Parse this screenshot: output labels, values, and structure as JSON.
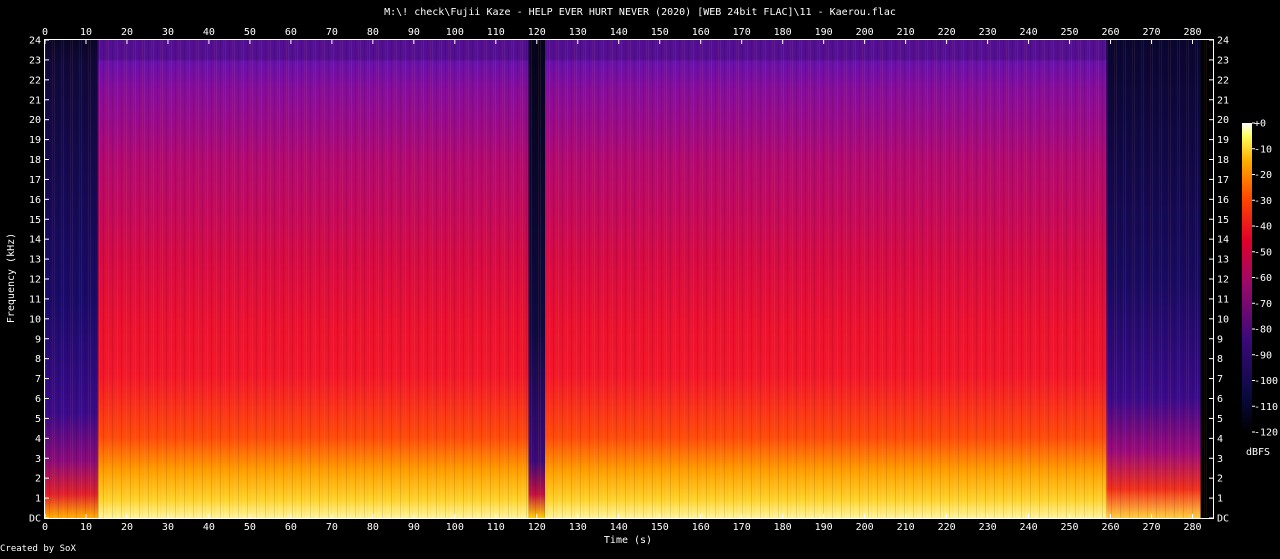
{
  "title": "M:\\! check\\Fujii Kaze - HELP EVER HURT NEVER (2020) [WEB 24bit FLAC]\\11 - Kaerou.flac",
  "footer": "Created by SoX",
  "chart_data": {
    "type": "heatmap",
    "title": "M:\\! check\\Fujii Kaze - HELP EVER HURT NEVER (2020) [WEB 24bit FLAC]\\11 - Kaerou.flac",
    "xlabel": "Time (s)",
    "ylabel": "Frequency (kHz)",
    "xlim": [
      0,
      285
    ],
    "ylim": [
      0,
      24
    ],
    "x_ticks": [
      0,
      10,
      20,
      30,
      40,
      50,
      60,
      70,
      80,
      90,
      100,
      110,
      120,
      130,
      140,
      150,
      160,
      170,
      180,
      190,
      200,
      210,
      220,
      230,
      240,
      250,
      260,
      270,
      280
    ],
    "y_ticks": [
      "DC",
      "1",
      "2",
      "3",
      "4",
      "5",
      "6",
      "7",
      "8",
      "9",
      "10",
      "11",
      "12",
      "13",
      "14",
      "15",
      "16",
      "17",
      "18",
      "19",
      "20",
      "21",
      "22",
      "23",
      "24"
    ],
    "duration_s": 282,
    "colorbar": {
      "label": "dBFS",
      "range": [
        -120,
        0
      ],
      "ticks": [
        "+0",
        "-10",
        "-20",
        "-30",
        "-40",
        "-50",
        "-60",
        "-70",
        "-80",
        "-90",
        "-100",
        "-110",
        "-120"
      ]
    },
    "segments": [
      {
        "start": 0,
        "end": 13,
        "level": "quiet"
      },
      {
        "start": 13,
        "end": 118,
        "level": "loud"
      },
      {
        "start": 118,
        "end": 122,
        "level": "quiet"
      },
      {
        "start": 122,
        "end": 259,
        "level": "loud"
      },
      {
        "start": 259,
        "end": 282,
        "level": "fade"
      }
    ],
    "grid": false,
    "legend": "right"
  }
}
